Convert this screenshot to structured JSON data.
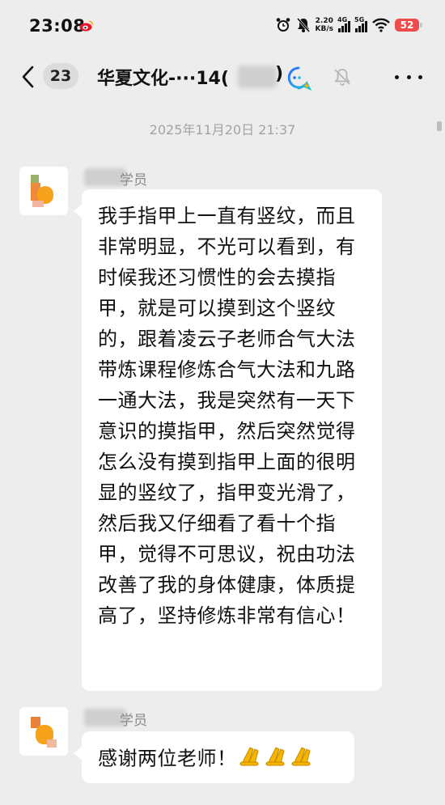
{
  "status_bar": {
    "time": "23:08",
    "net_speed_value": "2.20",
    "net_speed_unit": "KB/s",
    "signal1_label": "4G",
    "signal2_label": "5G",
    "battery": "52"
  },
  "header": {
    "unread_count": "23",
    "title_start": "华夏文化-···14(",
    "title_end": ")"
  },
  "chat": {
    "timestamp": "2025年11月20日 21:37",
    "messages": [
      {
        "sender_suffix": "学员",
        "text": "我手指甲上一直有竖纹，而且非常明显，不光可以看到，有时候我还习惯性的会去摸指甲，就是可以摸到这个竖纹的，跟着凌云子老师合气大法带炼课程修炼合气大法和九路一通大法，我是突然有一天下意识的摸指甲，然后突然觉得怎么没有摸到指甲上面的很明显的竖纹了，指甲变光滑了，然后我又仔细看了看十个指甲，觉得不可思议，祝由功法改善了我的身体健康，体质提高了，坚持修炼非常有信心！"
      },
      {
        "sender_suffix": "学员",
        "text": "感谢两位老师！",
        "emoji": "folded-hands-icon"
      }
    ]
  },
  "colors": {
    "background": "#ededed",
    "bubble": "#ffffff",
    "battery": "#f04b4b",
    "timestamp": "#a3a3a3"
  }
}
